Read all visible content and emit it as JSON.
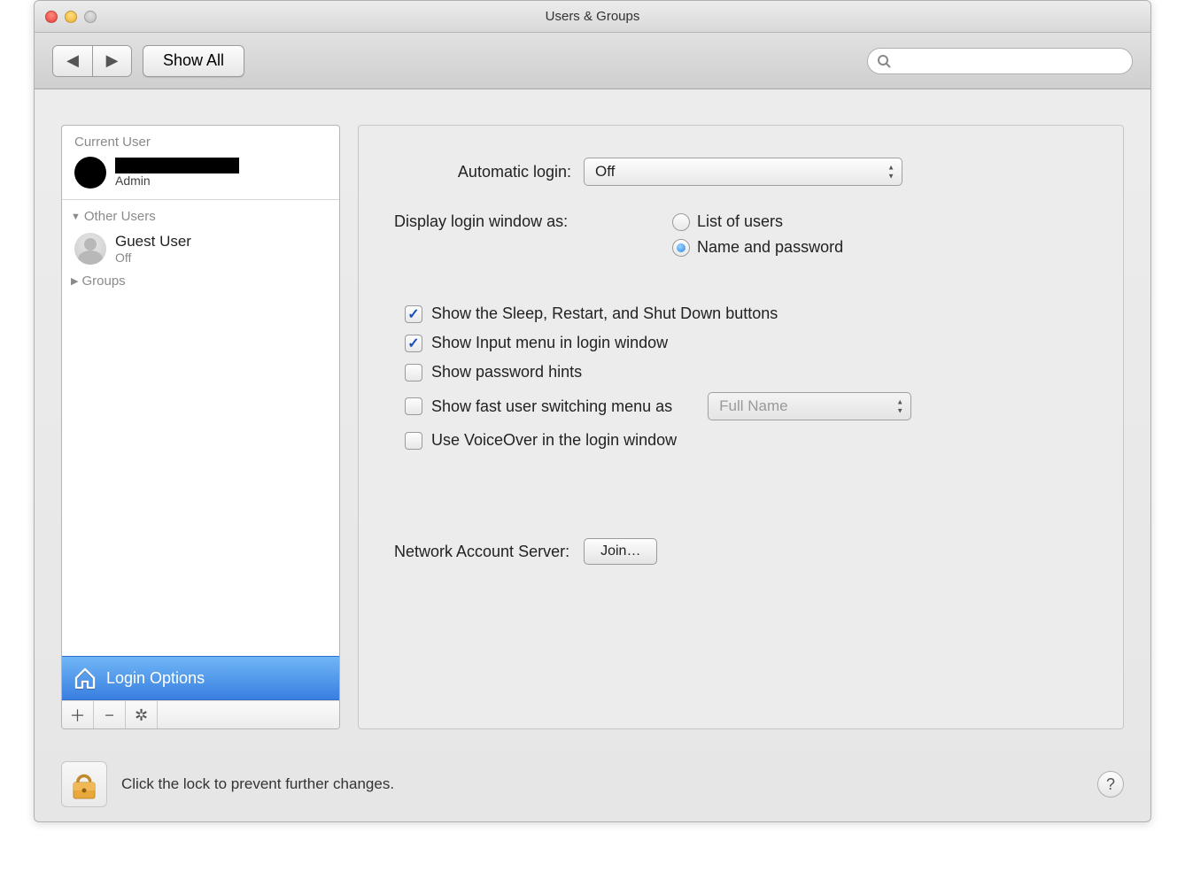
{
  "window": {
    "title": "Users & Groups"
  },
  "toolbar": {
    "show_all_label": "Show All",
    "search_placeholder": ""
  },
  "sidebar": {
    "current_user_label": "Current User",
    "current_user": {
      "name_redacted": true,
      "role": "Admin"
    },
    "other_users_label": "Other Users",
    "other_users": [
      {
        "name": "Guest User",
        "status": "Off"
      }
    ],
    "groups_label": "Groups",
    "login_options_label": "Login Options"
  },
  "settings": {
    "automatic_login_label": "Automatic login:",
    "automatic_login_value": "Off",
    "display_login_window_label": "Display login window as:",
    "display_login_window_options": {
      "list": "List of users",
      "name_password": "Name and password"
    },
    "display_login_window_selected": "name_password",
    "checkboxes": {
      "show_sleep_restart": {
        "label": "Show the Sleep, Restart, and Shut Down buttons",
        "checked": true
      },
      "show_input_menu": {
        "label": "Show Input menu in login window",
        "checked": true
      },
      "show_password_hints": {
        "label": "Show password hints",
        "checked": false
      },
      "show_fast_user_switching": {
        "label": "Show fast user switching menu as",
        "checked": false
      },
      "use_voiceover": {
        "label": "Use VoiceOver in the login window",
        "checked": false
      }
    },
    "fast_user_switching_value": "Full Name",
    "network_account_server_label": "Network Account Server:",
    "join_button_label": "Join…"
  },
  "footer": {
    "lock_text": "Click the lock to prevent further changes.",
    "help_label": "?"
  }
}
